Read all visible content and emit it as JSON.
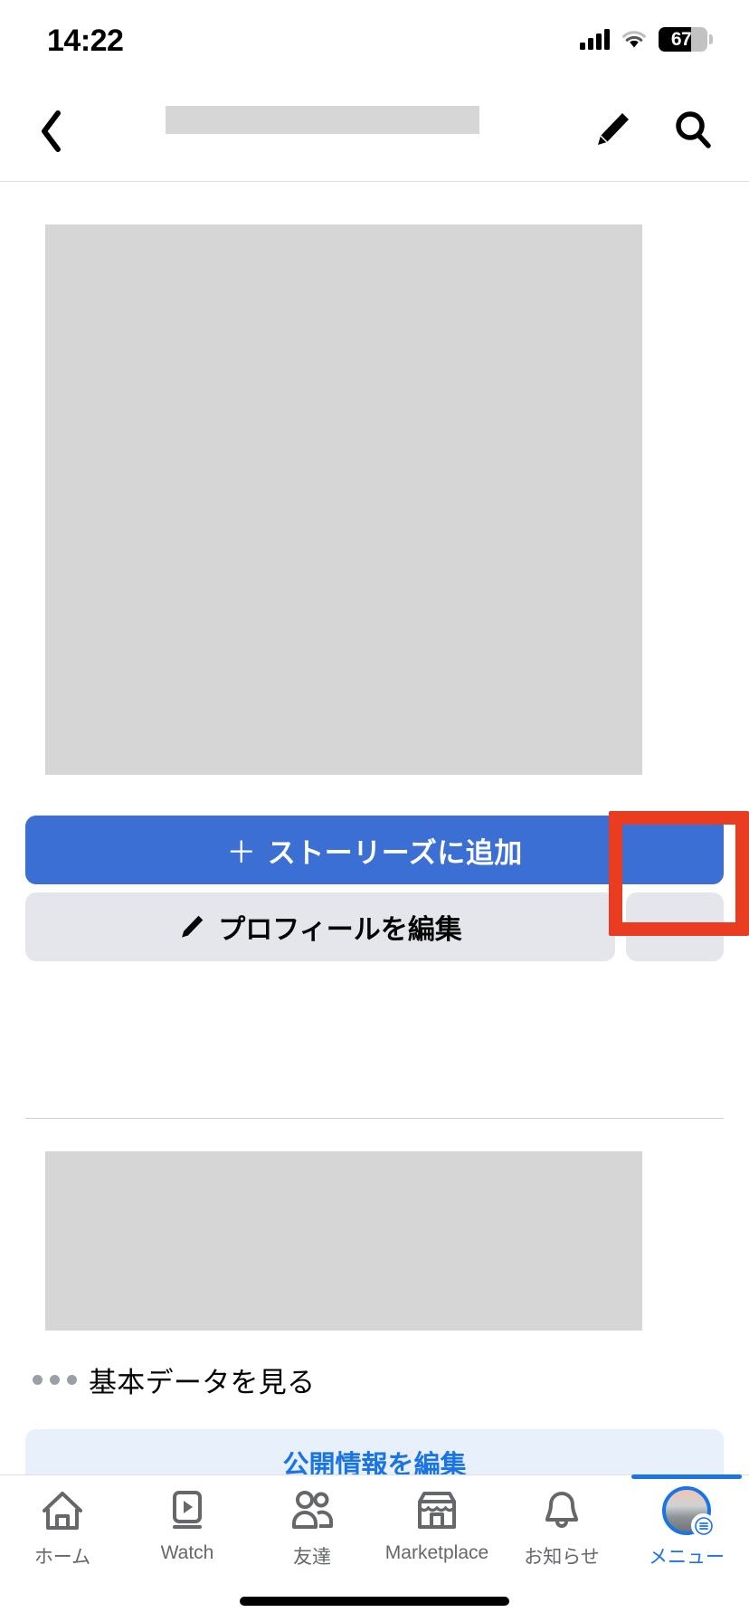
{
  "status_bar": {
    "time": "14:22",
    "battery_level": "67",
    "battery_percent": 67,
    "signal_icon": "cellular-signal-icon",
    "wifi_icon": "wifi-icon",
    "battery_icon": "battery-icon"
  },
  "nav_bar": {
    "back_icon": "chevron-left-icon",
    "title_redacted": "",
    "pencil_icon": "pencil-icon",
    "search_icon": "search-icon"
  },
  "profile": {
    "cover_placeholder": "",
    "bio_placeholder": "",
    "add_to_story_label": "ストーリーズに追加",
    "add_to_story_plus": "＋",
    "edit_profile_label": "プロフィールを編集",
    "edit_profile_icon": "pencil-icon",
    "more_options_icon": "ellipsis-icon",
    "see_basic_info_label": "基本データを見る",
    "see_basic_info_icon": "ellipsis-icon",
    "edit_public_info_label": "公開情報を編集"
  },
  "highlight": {
    "target": "more-options-button",
    "color": "#ea3c20"
  },
  "tab_bar": {
    "tabs": [
      {
        "label": "ホーム",
        "icon": "home-icon",
        "active": false
      },
      {
        "label": "Watch",
        "icon": "video-play-icon",
        "active": false
      },
      {
        "label": "友達",
        "icon": "friends-icon",
        "active": false
      },
      {
        "label": "Marketplace",
        "icon": "storefront-icon",
        "active": false
      },
      {
        "label": "お知らせ",
        "icon": "bell-icon",
        "active": false
      },
      {
        "label": "メニュー",
        "icon": "avatar-menu-icon",
        "active": true
      }
    ]
  },
  "colors": {
    "brand_blue": "#1b74e4",
    "story_button_blue": "#3b6fd4",
    "button_grey": "#e4e6eb",
    "public_info_bg": "#e7f0fb",
    "highlight_red": "#ea3c20",
    "redact_grey": "#d6d6d6"
  }
}
